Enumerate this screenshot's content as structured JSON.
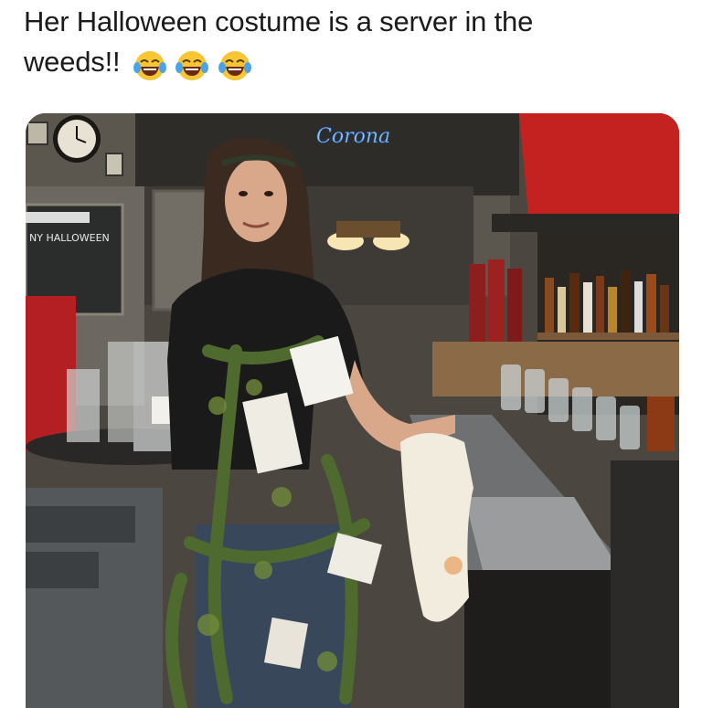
{
  "post": {
    "caption_line1": "Her Halloween costume is a server in the",
    "caption_line2": "weeds!!",
    "emoji": [
      "face-with-tears-of-joy",
      "face-with-tears-of-joy",
      "face-with-tears-of-joy"
    ]
  },
  "photo": {
    "neon_sign_text": "Corona",
    "chalkboard_text": "NY HALLOWEEN"
  }
}
